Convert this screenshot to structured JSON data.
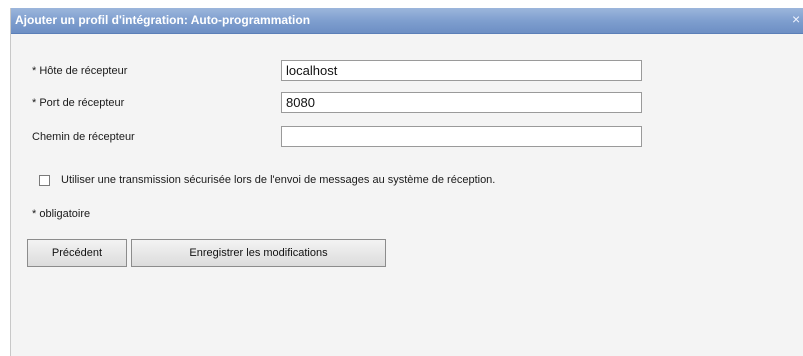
{
  "dialog": {
    "title": "Ajouter un profil d'intégration: Auto-programmation",
    "close_glyph": "×"
  },
  "form": {
    "host": {
      "label": "* Hôte de récepteur",
      "value": "localhost"
    },
    "port": {
      "label": "* Port de récepteur",
      "value": "8080"
    },
    "path": {
      "label": "Chemin de récepteur",
      "value": ""
    },
    "secure": {
      "label": "Utiliser une transmission sécurisée lors de l'envoi de messages au système de réception.",
      "checked": false
    },
    "required_note": "* obligatoire"
  },
  "buttons": {
    "previous": "Précédent",
    "save": "Enregistrer les modifications"
  },
  "colors": {
    "titlebar": "#7f9fcf",
    "dialog_bg": "#f4f4f4"
  },
  "icons": {
    "close": "close-icon"
  }
}
